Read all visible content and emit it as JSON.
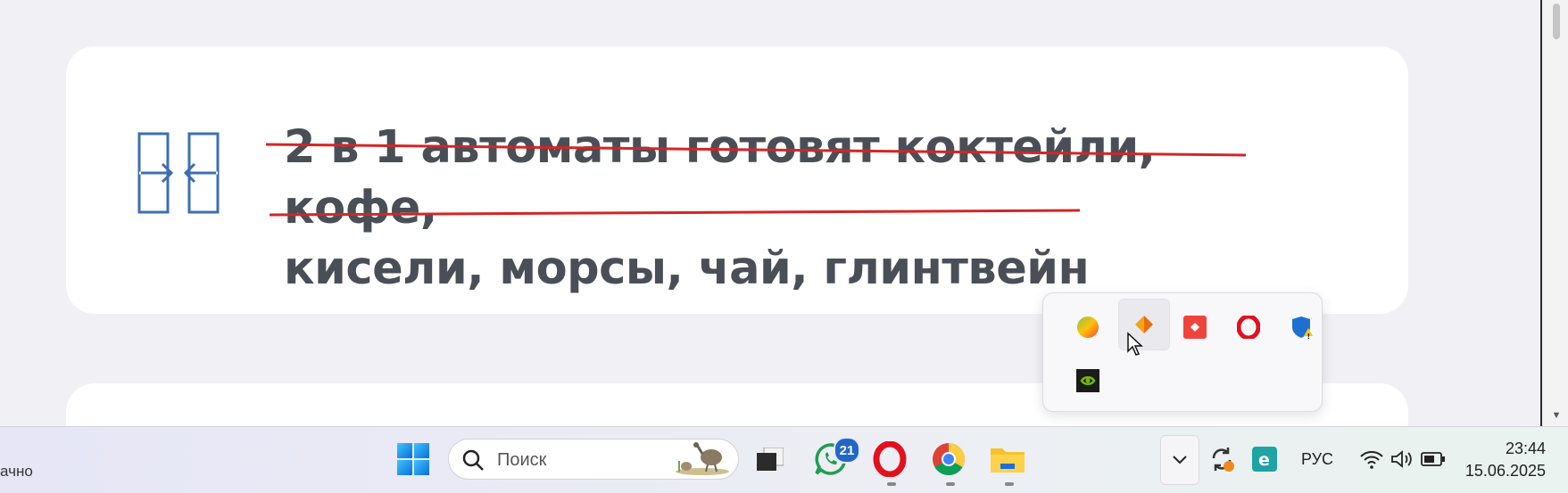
{
  "content": {
    "headline_line1": "2 в 1 автоматы готовят коктейли, кофе,",
    "headline_line2": "кисели, морсы, чай, глинтвейн"
  },
  "tray_overflow": {
    "icons": [
      "color-ball-icon",
      "orange-fan-icon",
      "anydesk-icon",
      "opera-icon",
      "windows-security-warning-icon",
      "nvidia-icon"
    ]
  },
  "taskbar": {
    "left_text": "ачно",
    "search_placeholder": "Поиск",
    "whatsapp_badge": "21",
    "apps": [
      "start-icon",
      "task-view-icon",
      "whatsapp-icon",
      "opera-icon",
      "chrome-icon",
      "file-explorer-icon"
    ]
  },
  "system_tray": {
    "language": "РУС",
    "time": "23:44",
    "date": "15.06.2025"
  },
  "colors": {
    "strike": "#d42525",
    "icon_blue": "#3d6fb0",
    "text": "#4a4f57"
  }
}
